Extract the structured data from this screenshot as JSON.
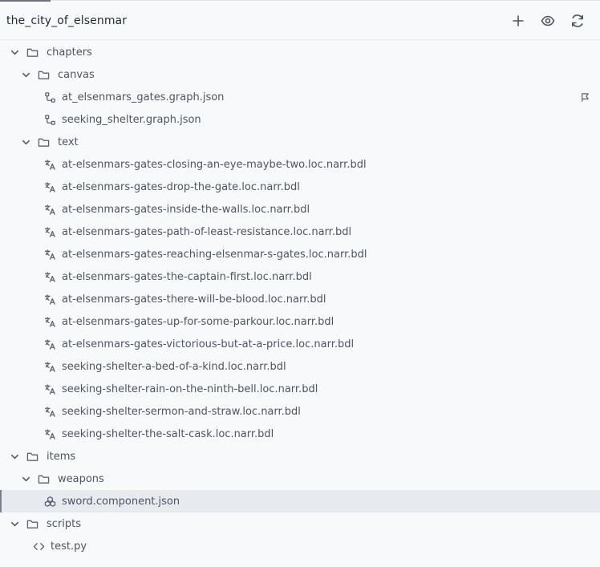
{
  "header": {
    "title": "the_city_of_elsenmar"
  },
  "tree": {
    "chapters": "chapters",
    "canvas": "canvas",
    "canvas_files": [
      "at_elsenmars_gates.graph.json",
      "seeking_shelter.graph.json"
    ],
    "text": "text",
    "text_files": [
      "at-elsenmars-gates-closing-an-eye-maybe-two.loc.narr.bdl",
      "at-elsenmars-gates-drop-the-gate.loc.narr.bdl",
      "at-elsenmars-gates-inside-the-walls.loc.narr.bdl",
      "at-elsenmars-gates-path-of-least-resistance.loc.narr.bdl",
      "at-elsenmars-gates-reaching-elsenmar-s-gates.loc.narr.bdl",
      "at-elsenmars-gates-the-captain-first.loc.narr.bdl",
      "at-elsenmars-gates-there-will-be-blood.loc.narr.bdl",
      "at-elsenmars-gates-up-for-some-parkour.loc.narr.bdl",
      "at-elsenmars-gates-victorious-but-at-a-price.loc.narr.bdl",
      "seeking-shelter-a-bed-of-a-kind.loc.narr.bdl",
      "seeking-shelter-rain-on-the-ninth-bell.loc.narr.bdl",
      "seeking-shelter-sermon-and-straw.loc.narr.bdl",
      "seeking-shelter-the-salt-cask.loc.narr.bdl"
    ],
    "items": "items",
    "weapons": "weapons",
    "weapon_file": "sword.component.json",
    "scripts": "scripts",
    "script_file": "test.py"
  }
}
